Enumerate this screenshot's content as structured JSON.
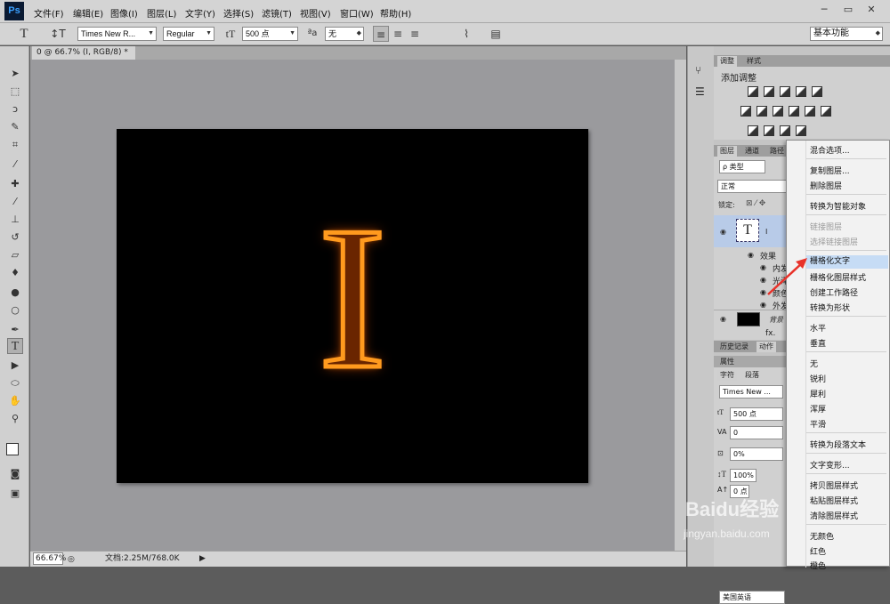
{
  "app": {
    "logo": "Ps"
  },
  "menu": [
    "文件(F)",
    "编辑(E)",
    "图像(I)",
    "图层(L)",
    "文字(Y)",
    "选择(S)",
    "滤镜(T)",
    "视图(V)",
    "窗口(W)",
    "帮助(H)"
  ],
  "window_controls": {
    "minimize": "─",
    "restore": "▭",
    "close": "✕"
  },
  "options": {
    "font_family": "Times New R...",
    "font_style": "Regular",
    "font_size": "500 点",
    "aa_label": "ªa",
    "antialias": "无",
    "workspace": "基本功能"
  },
  "document": {
    "tab_title": "0 @ 66.7% (I, RGB/8) *",
    "tab_close": "×",
    "glyph": "I"
  },
  "status": {
    "zoom": "66.67%",
    "doc_info": "文档:2.25M/768.0K"
  },
  "adjust_panel": {
    "tabs": [
      "调整",
      "样式"
    ],
    "title": "添加调整"
  },
  "layers_panel": {
    "tabs": [
      "图层",
      "通道",
      "路径"
    ],
    "filter": "ρ 类型",
    "blend": "正常",
    "lock_label": "锁定:",
    "text_layer_thumb": "T",
    "text_layer_name": "I",
    "effects_label": "效果",
    "effects": [
      "内发",
      "光泽",
      "颜色",
      "外发"
    ],
    "bg_layer_name": "背景",
    "fx": "fx."
  },
  "history_panel": {
    "tabs": [
      "历史记录",
      "动作"
    ]
  },
  "props_panel": {
    "title": "属性",
    "tabs": [
      "字符",
      "段落"
    ],
    "font": "Times New ...",
    "size": "500 点",
    "kerning": "0",
    "tracking": "0%",
    "vscale": "100%",
    "baseline": "0 点",
    "language": "美国英语"
  },
  "context_menu": {
    "items": [
      {
        "label": "混合选项...",
        "disabled": false
      },
      {
        "label": "复制图层...",
        "disabled": false
      },
      {
        "label": "删除图层",
        "disabled": false
      },
      {
        "label": "转换为智能对象",
        "disabled": false
      },
      {
        "label": "链接图层",
        "disabled": true
      },
      {
        "label": "选择链接图层",
        "disabled": true
      },
      {
        "label": "栅格化文字",
        "disabled": false,
        "highlight": true
      },
      {
        "label": "栅格化图层样式",
        "disabled": false
      },
      {
        "label": "创建工作路径",
        "disabled": false
      },
      {
        "label": "转换为形状",
        "disabled": false
      },
      {
        "label": "水平",
        "disabled": false
      },
      {
        "label": "垂直",
        "disabled": false
      },
      {
        "label": "无",
        "disabled": false
      },
      {
        "label": "锐利",
        "disabled": false
      },
      {
        "label": "犀利",
        "disabled": false
      },
      {
        "label": "浑厚",
        "disabled": false
      },
      {
        "label": "平滑",
        "disabled": false
      },
      {
        "label": "转换为段落文本",
        "disabled": false
      },
      {
        "label": "文字变形...",
        "disabled": false
      },
      {
        "label": "拷贝图层样式",
        "disabled": false
      },
      {
        "label": "粘贴图层样式",
        "disabled": false
      },
      {
        "label": "清除图层样式",
        "disabled": false
      },
      {
        "label": "无颜色",
        "disabled": false
      },
      {
        "label": "红色",
        "disabled": false
      },
      {
        "label": "橙色",
        "disabled": false
      }
    ]
  },
  "watermark": {
    "text": "Baidu经验",
    "url": "jingyan.baidu.com"
  },
  "colors": {
    "glyph_outline": "#ff9a1e",
    "glyph_glow": "#ff7a00",
    "menu_highlight": "#c6dcf5",
    "arrow": "#e8322a"
  }
}
